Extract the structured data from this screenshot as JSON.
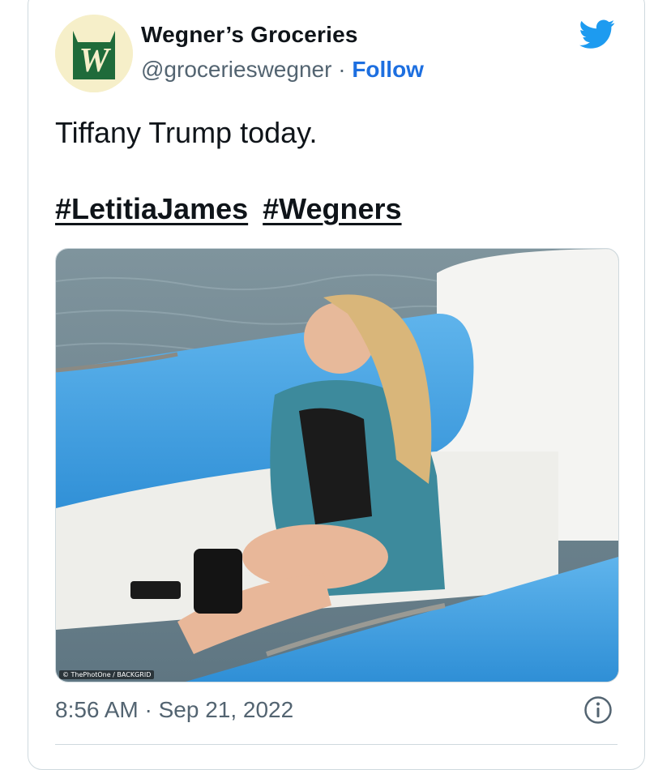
{
  "account": {
    "name": "Wegner’s Groceries",
    "handle": "@grocerieswegner",
    "separator": " · ",
    "follow_label": "Follow",
    "avatar_letter": "W",
    "avatar_icon": "wegners-logo"
  },
  "tweet": {
    "text": "Tiffany Trump today.",
    "hashtags": [
      "#LetitiaJames",
      "#Wegners"
    ]
  },
  "media": {
    "watermark": "© ThePhotOne / BACKGRID"
  },
  "footer": {
    "timestamp": "8:56 AM · Sep 21, 2022"
  },
  "icons": {
    "brand": "twitter-bird-icon",
    "info": "info-icon"
  },
  "colors": {
    "follow": "#1d6fe0",
    "twitter_blue": "#1d9bf0",
    "muted_text": "#536471",
    "border": "#cfd9de"
  }
}
